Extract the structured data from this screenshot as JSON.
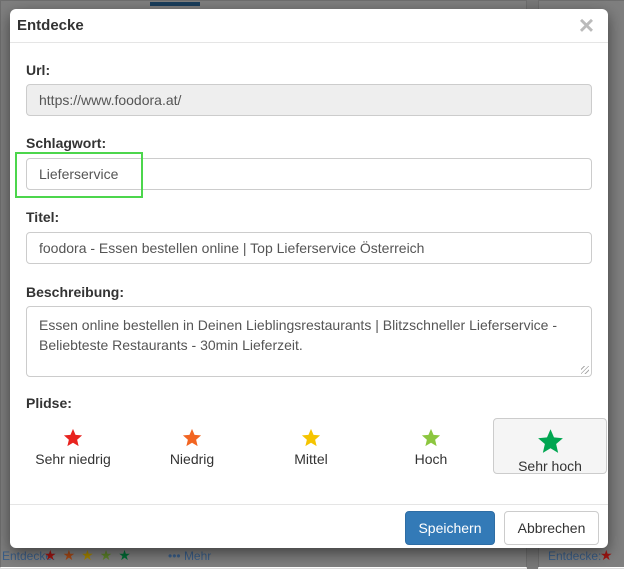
{
  "modal": {
    "title": "Entdecke",
    "close_symbol": "×",
    "url_label": "Url:",
    "url_value": "https://www.foodora.at/",
    "keyword_label": "Schlagwort:",
    "keyword_value": "Lieferservice",
    "title_label": "Titel:",
    "title_value": "foodora - Essen bestellen online | Top Lieferservice Österreich",
    "description_label": "Beschreibung:",
    "description_value": "Essen online bestellen in Deinen Lieblingsrestaurants | Blitzschneller Lieferservice - Beliebteste Restaurants - 30min Lieferzeit.",
    "rating_label": "Plidse:",
    "rating_options": [
      {
        "label": "Sehr niedrig",
        "color": "#e8231f"
      },
      {
        "label": "Niedrig",
        "color": "#f26522"
      },
      {
        "label": "Mittel",
        "color": "#f5c400"
      },
      {
        "label": "Hoch",
        "color": "#8cc63f"
      },
      {
        "label": "Sehr hoch",
        "color": "#00a651",
        "selected": true
      }
    ],
    "save_label": "Speichern",
    "cancel_label": "Abbrechen"
  },
  "background": {
    "bottom_left_label": "Entdecke:",
    "bottom_left_more": "••• Mehr",
    "bottom_right_label": "Entdecke:"
  },
  "colors": {
    "primary": "#337ab7",
    "highlight": "#4cd64c"
  }
}
